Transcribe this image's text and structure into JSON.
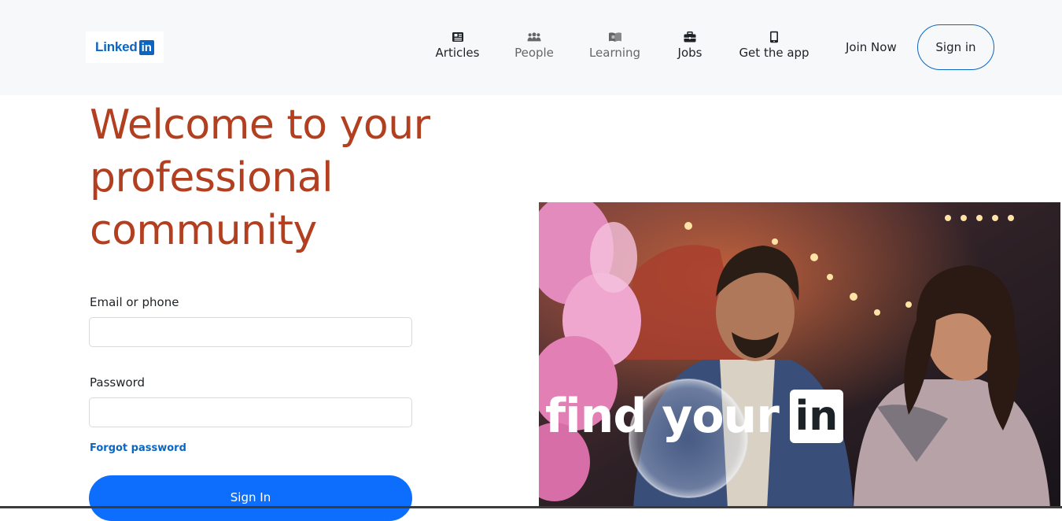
{
  "brand": {
    "logo_word": "Linked",
    "logo_box": "in"
  },
  "nav": {
    "items": [
      {
        "label": "Articles",
        "icon": "articles-icon"
      },
      {
        "label": "People",
        "icon": "people-icon"
      },
      {
        "label": "Learning",
        "icon": "learning-icon"
      },
      {
        "label": "Jobs",
        "icon": "jobs-icon"
      },
      {
        "label": "Get the app",
        "icon": "phone-icon"
      }
    ],
    "join_now": "Join Now",
    "sign_in": "Sign in"
  },
  "main": {
    "headline": "Welcome to your professional community",
    "email_label": "Email or phone",
    "email_value": "",
    "password_label": "Password",
    "password_value": "",
    "forgot_password": "Forgot password",
    "submit_label": "Sign In"
  },
  "hero": {
    "tagline": "find your",
    "tagline_box": "in"
  },
  "colors": {
    "accent": "#0a66c2",
    "headline": "#b24020",
    "primary_button": "#0d6efd",
    "topbar_bg": "#f7f8fa"
  }
}
